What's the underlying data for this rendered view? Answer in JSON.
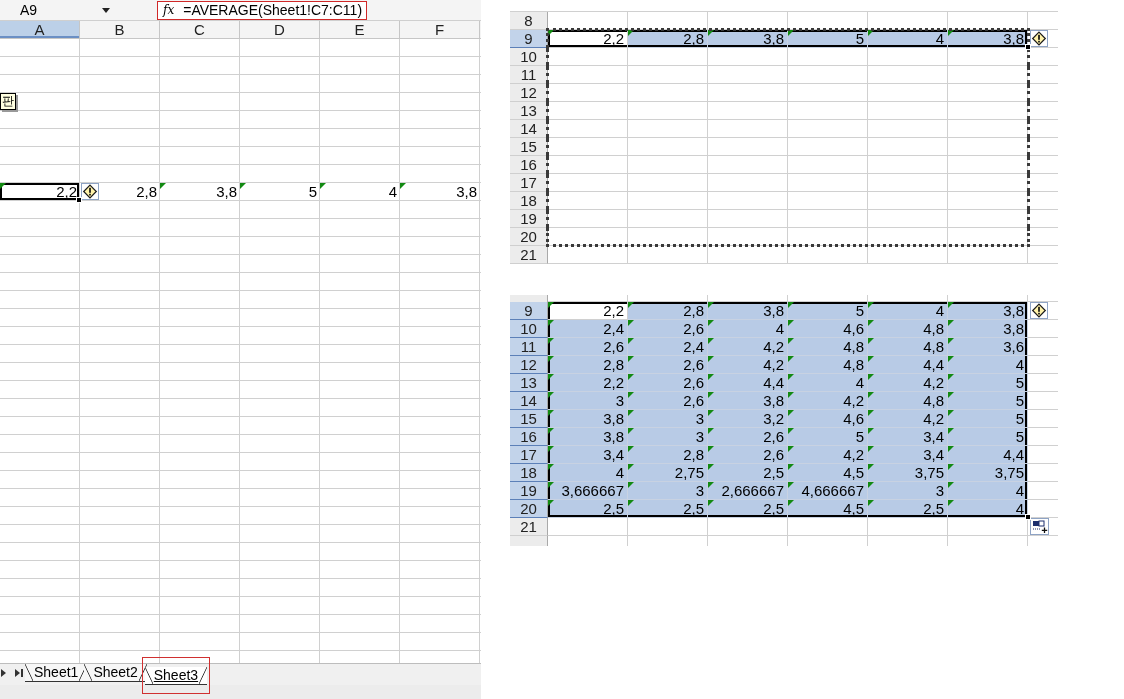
{
  "left_window": {
    "name_box": {
      "value": "A9"
    },
    "formula_bar": {
      "fx_label": "fx",
      "formula": "=AVERAGE(Sheet1!C7:C11)",
      "highlighted": true
    },
    "columns": [
      {
        "label": "A",
        "selected": true
      },
      {
        "label": "B",
        "selected": false
      },
      {
        "label": "C",
        "selected": false
      },
      {
        "label": "D",
        "selected": false
      },
      {
        "label": "E",
        "selected": false
      },
      {
        "label": "F",
        "selected": false
      }
    ],
    "tooltip": "판",
    "active_row": {
      "error_indicator": true,
      "cells": [
        {
          "value": "2,2",
          "active": true,
          "flagged": true
        },
        {
          "value": "2,8",
          "active": false,
          "flagged": false
        },
        {
          "value": "3,8",
          "active": false,
          "flagged": true
        },
        {
          "value": "5",
          "active": false,
          "flagged": true
        },
        {
          "value": "4",
          "active": false,
          "flagged": true
        },
        {
          "value": "3,8",
          "active": false,
          "flagged": true
        }
      ]
    },
    "sheet_tabs": [
      {
        "label": "Sheet1",
        "selected": false,
        "highlighted": false
      },
      {
        "label": "Sheet2",
        "selected": false,
        "highlighted": false
      },
      {
        "label": "Sheet3",
        "selected": true,
        "highlighted": true
      }
    ]
  },
  "top_panel": {
    "error_indicator": true,
    "rows": [
      {
        "header": "8",
        "selected": false,
        "marquee": false
      },
      {
        "header": "9",
        "selected": true,
        "marquee": true,
        "cells": [
          {
            "value": "2,2",
            "selected": false,
            "flagged": true
          },
          {
            "value": "2,8",
            "selected": true,
            "flagged": true
          },
          {
            "value": "3,8",
            "selected": true,
            "flagged": true
          },
          {
            "value": "5",
            "selected": true,
            "flagged": true
          },
          {
            "value": "4",
            "selected": true,
            "flagged": true
          },
          {
            "value": "3,8",
            "selected": true,
            "flagged": true
          }
        ]
      },
      {
        "header": "10",
        "selected": false,
        "marquee": true
      },
      {
        "header": "11",
        "selected": false,
        "marquee": true
      },
      {
        "header": "12",
        "selected": false,
        "marquee": true
      },
      {
        "header": "13",
        "selected": false,
        "marquee": true
      },
      {
        "header": "14",
        "selected": false,
        "marquee": true
      },
      {
        "header": "15",
        "selected": false,
        "marquee": true
      },
      {
        "header": "16",
        "selected": false,
        "marquee": true
      },
      {
        "header": "17",
        "selected": false,
        "marquee": true
      },
      {
        "header": "18",
        "selected": false,
        "marquee": true
      },
      {
        "header": "19",
        "selected": false,
        "marquee": true
      },
      {
        "header": "20",
        "selected": false,
        "marquee": true
      },
      {
        "header": "21",
        "selected": false,
        "marquee": false
      }
    ]
  },
  "bottom_panel": {
    "error_indicator": true,
    "paste_options": true,
    "rows": [
      {
        "header": "9",
        "selected": true,
        "cells": [
          {
            "value": "2,2",
            "selected": false,
            "flagged": true
          },
          {
            "value": "2,8",
            "selected": true,
            "flagged": true
          },
          {
            "value": "3,8",
            "selected": true,
            "flagged": true
          },
          {
            "value": "5",
            "selected": true,
            "flagged": true
          },
          {
            "value": "4",
            "selected": true,
            "flagged": true
          },
          {
            "value": "3,8",
            "selected": true,
            "flagged": true
          }
        ]
      },
      {
        "header": "10",
        "selected": true,
        "cells": [
          {
            "value": "2,4",
            "selected": true,
            "flagged": true
          },
          {
            "value": "2,6",
            "selected": true,
            "flagged": true
          },
          {
            "value": "4",
            "selected": true,
            "flagged": true
          },
          {
            "value": "4,6",
            "selected": true,
            "flagged": true
          },
          {
            "value": "4,8",
            "selected": true,
            "flagged": true
          },
          {
            "value": "3,8",
            "selected": true,
            "flagged": true
          }
        ]
      },
      {
        "header": "11",
        "selected": true,
        "cells": [
          {
            "value": "2,6",
            "selected": true,
            "flagged": true
          },
          {
            "value": "2,4",
            "selected": true,
            "flagged": true
          },
          {
            "value": "4,2",
            "selected": true,
            "flagged": true
          },
          {
            "value": "4,8",
            "selected": true,
            "flagged": true
          },
          {
            "value": "4,8",
            "selected": true,
            "flagged": true
          },
          {
            "value": "3,6",
            "selected": true,
            "flagged": true
          }
        ]
      },
      {
        "header": "12",
        "selected": true,
        "cells": [
          {
            "value": "2,8",
            "selected": true,
            "flagged": true
          },
          {
            "value": "2,6",
            "selected": true,
            "flagged": true
          },
          {
            "value": "4,2",
            "selected": true,
            "flagged": true
          },
          {
            "value": "4,8",
            "selected": true,
            "flagged": true
          },
          {
            "value": "4,4",
            "selected": true,
            "flagged": true
          },
          {
            "value": "4",
            "selected": true,
            "flagged": true
          }
        ]
      },
      {
        "header": "13",
        "selected": true,
        "cells": [
          {
            "value": "2,2",
            "selected": true,
            "flagged": true
          },
          {
            "value": "2,6",
            "selected": true,
            "flagged": true
          },
          {
            "value": "4,4",
            "selected": true,
            "flagged": true
          },
          {
            "value": "4",
            "selected": true,
            "flagged": true
          },
          {
            "value": "4,2",
            "selected": true,
            "flagged": true
          },
          {
            "value": "5",
            "selected": true,
            "flagged": true
          }
        ]
      },
      {
        "header": "14",
        "selected": true,
        "cells": [
          {
            "value": "3",
            "selected": true,
            "flagged": true
          },
          {
            "value": "2,6",
            "selected": true,
            "flagged": true
          },
          {
            "value": "3,8",
            "selected": true,
            "flagged": true
          },
          {
            "value": "4,2",
            "selected": true,
            "flagged": true
          },
          {
            "value": "4,8",
            "selected": true,
            "flagged": true
          },
          {
            "value": "5",
            "selected": true,
            "flagged": true
          }
        ]
      },
      {
        "header": "15",
        "selected": true,
        "cells": [
          {
            "value": "3,8",
            "selected": true,
            "flagged": true
          },
          {
            "value": "3",
            "selected": true,
            "flagged": true
          },
          {
            "value": "3,2",
            "selected": true,
            "flagged": true
          },
          {
            "value": "4,6",
            "selected": true,
            "flagged": true
          },
          {
            "value": "4,2",
            "selected": true,
            "flagged": true
          },
          {
            "value": "5",
            "selected": true,
            "flagged": true
          }
        ]
      },
      {
        "header": "16",
        "selected": true,
        "cells": [
          {
            "value": "3,8",
            "selected": true,
            "flagged": true
          },
          {
            "value": "3",
            "selected": true,
            "flagged": true
          },
          {
            "value": "2,6",
            "selected": true,
            "flagged": true
          },
          {
            "value": "5",
            "selected": true,
            "flagged": true
          },
          {
            "value": "3,4",
            "selected": true,
            "flagged": true
          },
          {
            "value": "5",
            "selected": true,
            "flagged": true
          }
        ]
      },
      {
        "header": "17",
        "selected": true,
        "cells": [
          {
            "value": "3,4",
            "selected": true,
            "flagged": true
          },
          {
            "value": "2,8",
            "selected": true,
            "flagged": true
          },
          {
            "value": "2,6",
            "selected": true,
            "flagged": true
          },
          {
            "value": "4,2",
            "selected": true,
            "flagged": true
          },
          {
            "value": "3,4",
            "selected": true,
            "flagged": true
          },
          {
            "value": "4,4",
            "selected": true,
            "flagged": true
          }
        ]
      },
      {
        "header": "18",
        "selected": true,
        "cells": [
          {
            "value": "4",
            "selected": true,
            "flagged": true
          },
          {
            "value": "2,75",
            "selected": true,
            "flagged": true
          },
          {
            "value": "2,5",
            "selected": true,
            "flagged": true
          },
          {
            "value": "4,5",
            "selected": true,
            "flagged": true
          },
          {
            "value": "3,75",
            "selected": true,
            "flagged": true
          },
          {
            "value": "3,75",
            "selected": true,
            "flagged": true
          }
        ]
      },
      {
        "header": "19",
        "selected": true,
        "cells": [
          {
            "value": "3,666667",
            "selected": true,
            "flagged": true
          },
          {
            "value": "3",
            "selected": true,
            "flagged": true
          },
          {
            "value": "2,666667",
            "selected": true,
            "flagged": true
          },
          {
            "value": "4,666667",
            "selected": true,
            "flagged": true
          },
          {
            "value": "3",
            "selected": true,
            "flagged": true
          },
          {
            "value": "4",
            "selected": true,
            "flagged": true
          }
        ]
      },
      {
        "header": "20",
        "selected": true,
        "cells": [
          {
            "value": "2,5",
            "selected": true,
            "flagged": true
          },
          {
            "value": "2,5",
            "selected": true,
            "flagged": true
          },
          {
            "value": "2,5",
            "selected": true,
            "flagged": true
          },
          {
            "value": "4,5",
            "selected": true,
            "flagged": true
          },
          {
            "value": "2,5",
            "selected": true,
            "flagged": true
          },
          {
            "value": "4",
            "selected": true,
            "flagged": true
          }
        ]
      },
      {
        "header": "21",
        "selected": false
      }
    ]
  }
}
